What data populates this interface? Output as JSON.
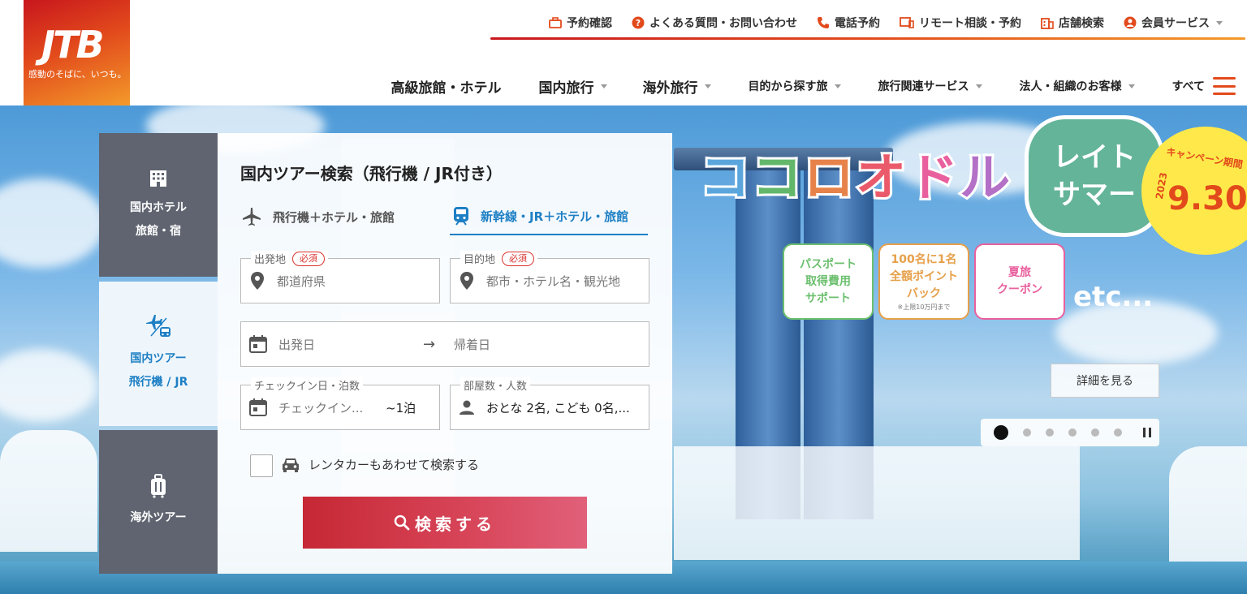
{
  "brand": {
    "logo": "JTB",
    "tagline": "感動のそばに、いつも。",
    "colors": {
      "accent": "#e24a1c",
      "primary_blue": "#1d7fc4",
      "search_red": "#c62834"
    }
  },
  "util_nav": [
    {
      "label": "予約確認",
      "icon": "briefcase-icon"
    },
    {
      "label": "よくある質問・お問い合わせ",
      "icon": "question-icon"
    },
    {
      "label": "電話予約",
      "icon": "phone-icon"
    },
    {
      "label": "リモート相談・予約",
      "icon": "monitor-icon"
    },
    {
      "label": "店舗検索",
      "icon": "building-icon"
    },
    {
      "label": "会員サービス",
      "icon": "user-icon"
    }
  ],
  "main_nav": [
    {
      "label": "高級旅館・ホテル"
    },
    {
      "label": "国内旅行"
    },
    {
      "label": "海外旅行"
    },
    {
      "label": "目的から探す旅"
    },
    {
      "label": "旅行関連サービス"
    },
    {
      "label": "法人・組織のお客様"
    },
    {
      "label": "すべて"
    }
  ],
  "side_tabs": [
    {
      "line1": "国内ホテル",
      "line2": "旅館・宿",
      "icon": "hotel-icon"
    },
    {
      "line1": "国内ツアー",
      "line2": "飛行機 / JR",
      "icon": "plane-train-icon"
    },
    {
      "line1": "海外ツアー",
      "line2": "",
      "icon": "suitcase-icon"
    }
  ],
  "search": {
    "title": "国内ツアー検索（飛行機 / JR付き）",
    "modes": [
      {
        "label": "飛行機＋ホテル・旅館"
      },
      {
        "label": "新幹線・JR＋ホテル・旅館"
      }
    ],
    "required_badge": "必須",
    "departure": {
      "label": "出発地",
      "placeholder": "都道府県"
    },
    "destination": {
      "label": "目的地",
      "placeholder": "都市・ホテル名・観光地"
    },
    "dates": {
      "depart_placeholder": "出発日",
      "arrow": "→",
      "return_placeholder": "帰着日"
    },
    "checkin": {
      "label": "チェックイン日・泊数",
      "placeholder": "チェックイン...",
      "nights": "~1泊"
    },
    "rooms": {
      "label": "部屋数・人数",
      "value": "おとな 2名, こども 0名,..."
    },
    "rentacar_label": "レンタカーもあわせて検索する",
    "button_label": "検索する"
  },
  "campaign": {
    "headline": [
      "コ",
      "コ",
      "ロ",
      "オ",
      "ド",
      "ル"
    ],
    "headline_colors": [
      "#5aa6dc",
      "#62b76a",
      "#e6824a",
      "#ea5a6a",
      "#e9609e",
      "#b46fc6"
    ],
    "sub_line1": "レイト",
    "sub_line2": "サマー",
    "badge_top": "キャンペーン期間",
    "badge_year": "2023",
    "badge_date": "9.30",
    "promos": [
      {
        "line1": "パスポート",
        "line2": "取得費用",
        "line3": "サポート",
        "note": "",
        "color": "#6cbf6e"
      },
      {
        "line1": "100名に1名",
        "line2": "全額ポイント",
        "line3": "バック",
        "note": "※上限10万円まで",
        "color": "#e6a04a"
      },
      {
        "line1": "夏旅",
        "line2": "クーポン",
        "line3": "",
        "note": "",
        "color": "#e9609e"
      }
    ],
    "etc": "etc...",
    "detail_button": "詳細を見る",
    "slides_total": 6,
    "slide_current": 1
  }
}
